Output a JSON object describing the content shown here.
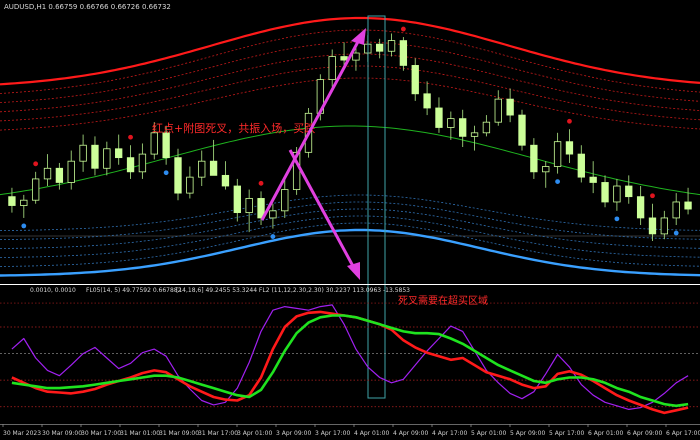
{
  "colors": {
    "background": "#000000",
    "candle_body": "#ccff99",
    "candle_wick": "#9fd27a",
    "upper_band_main": "#ff1a1a",
    "upper_band_dotted": "#c21a1a",
    "lower_band_main": "#3aa0ff",
    "lower_band_dotted": "#2f6fb0",
    "midline": "#1fb31f",
    "buy_dot": "#2d8cf0",
    "sell_dot": "#e0141e",
    "annotation_text": "#ff2a2a",
    "arrow": "#e040e0",
    "highlight_box": "#3fa3a8",
    "panel_divider": "#ffffff",
    "osc_fast": "#ff1a1a",
    "osc_slow": "#1fe31f",
    "osc_purple": "#a020f0",
    "osc_levels": "#b22222"
  },
  "main_panel": {
    "symbol_info": "AUDUSD,H1  0.66759 0.66766 0.66726 0.66732",
    "annotation": "红点+附图死叉，共振入场，买跌"
  },
  "sub_panel": {
    "info_left": "0.0010, 0.0010",
    "info_mid": "FL05(14, 5) 49.77592 0.667882",
    "info_right": "[14,18,6] 49.2455 53.3244  FL2 (11,12,2.30,2.30) 30.2237 113.0963 -13.5853",
    "annotation": "死叉需要在超买区域"
  },
  "x_axis": {
    "labels": [
      "30 Mar 2023",
      "30 Mar 09:00",
      "30 Mar 17:00",
      "31 Mar 01:00",
      "31 Mar 09:00",
      "31 Mar 17:00",
      "3 Apr 01:00",
      "3 Apr 09:00",
      "3 Apr 17:00",
      "4 Apr 01:00",
      "4 Apr 09:00",
      "4 Apr 17:00",
      "5 Apr 01:00",
      "5 Apr 09:00",
      "5 Apr 17:00",
      "6 Apr 01:00",
      "6 Apr 09:00",
      "6 Apr 17:00"
    ]
  },
  "chart_data": [
    {
      "type": "candlestick",
      "title": "AUDUSD,H1",
      "ylim": [
        0.6655,
        0.6805
      ],
      "candles": [
        {
          "o": 0.6702,
          "h": 0.6707,
          "l": 0.6693,
          "c": 0.6697
        },
        {
          "o": 0.6697,
          "h": 0.6703,
          "l": 0.669,
          "c": 0.67
        },
        {
          "o": 0.67,
          "h": 0.6716,
          "l": 0.6698,
          "c": 0.6712
        },
        {
          "o": 0.6712,
          "h": 0.6726,
          "l": 0.6708,
          "c": 0.6718
        },
        {
          "o": 0.6718,
          "h": 0.6721,
          "l": 0.6706,
          "c": 0.671
        },
        {
          "o": 0.671,
          "h": 0.6728,
          "l": 0.6706,
          "c": 0.6722
        },
        {
          "o": 0.6722,
          "h": 0.6737,
          "l": 0.6716,
          "c": 0.6731
        },
        {
          "o": 0.6731,
          "h": 0.6736,
          "l": 0.6714,
          "c": 0.6718
        },
        {
          "o": 0.6718,
          "h": 0.6733,
          "l": 0.6714,
          "c": 0.6729
        },
        {
          "o": 0.6729,
          "h": 0.6737,
          "l": 0.672,
          "c": 0.6724
        },
        {
          "o": 0.6724,
          "h": 0.6731,
          "l": 0.6712,
          "c": 0.6716
        },
        {
          "o": 0.6716,
          "h": 0.6732,
          "l": 0.6712,
          "c": 0.6726
        },
        {
          "o": 0.6726,
          "h": 0.6744,
          "l": 0.6723,
          "c": 0.6738
        },
        {
          "o": 0.6738,
          "h": 0.6742,
          "l": 0.672,
          "c": 0.6724
        },
        {
          "o": 0.6724,
          "h": 0.6729,
          "l": 0.67,
          "c": 0.6704
        },
        {
          "o": 0.6704,
          "h": 0.6719,
          "l": 0.6701,
          "c": 0.6713
        },
        {
          "o": 0.6713,
          "h": 0.6728,
          "l": 0.6708,
          "c": 0.6722
        },
        {
          "o": 0.6722,
          "h": 0.6734,
          "l": 0.6716,
          "c": 0.6714
        },
        {
          "o": 0.6714,
          "h": 0.6722,
          "l": 0.6706,
          "c": 0.6708
        },
        {
          "o": 0.6708,
          "h": 0.6712,
          "l": 0.6688,
          "c": 0.6693
        },
        {
          "o": 0.6693,
          "h": 0.6706,
          "l": 0.6682,
          "c": 0.6701
        },
        {
          "o": 0.6701,
          "h": 0.6705,
          "l": 0.6686,
          "c": 0.669
        },
        {
          "o": 0.669,
          "h": 0.6698,
          "l": 0.6684,
          "c": 0.6694
        },
        {
          "o": 0.6694,
          "h": 0.6712,
          "l": 0.669,
          "c": 0.6706
        },
        {
          "o": 0.6706,
          "h": 0.673,
          "l": 0.6703,
          "c": 0.6727
        },
        {
          "o": 0.6727,
          "h": 0.6752,
          "l": 0.6724,
          "c": 0.6749
        },
        {
          "o": 0.6749,
          "h": 0.6771,
          "l": 0.6745,
          "c": 0.6768
        },
        {
          "o": 0.6768,
          "h": 0.6785,
          "l": 0.6764,
          "c": 0.6781
        },
        {
          "o": 0.6781,
          "h": 0.6789,
          "l": 0.6774,
          "c": 0.6779
        },
        {
          "o": 0.6779,
          "h": 0.6786,
          "l": 0.6773,
          "c": 0.6783
        },
        {
          "o": 0.6783,
          "h": 0.6793,
          "l": 0.6778,
          "c": 0.6788
        },
        {
          "o": 0.6788,
          "h": 0.6791,
          "l": 0.678,
          "c": 0.6784
        },
        {
          "o": 0.6784,
          "h": 0.6794,
          "l": 0.6781,
          "c": 0.679
        },
        {
          "o": 0.679,
          "h": 0.6792,
          "l": 0.6773,
          "c": 0.6776
        },
        {
          "o": 0.6776,
          "h": 0.678,
          "l": 0.6756,
          "c": 0.676
        },
        {
          "o": 0.676,
          "h": 0.6767,
          "l": 0.6748,
          "c": 0.6752
        },
        {
          "o": 0.6752,
          "h": 0.6758,
          "l": 0.6738,
          "c": 0.6741
        },
        {
          "o": 0.6741,
          "h": 0.675,
          "l": 0.6734,
          "c": 0.6746
        },
        {
          "o": 0.6746,
          "h": 0.6751,
          "l": 0.673,
          "c": 0.6736
        },
        {
          "o": 0.6736,
          "h": 0.6742,
          "l": 0.6728,
          "c": 0.6738
        },
        {
          "o": 0.6738,
          "h": 0.6748,
          "l": 0.6736,
          "c": 0.6744
        },
        {
          "o": 0.6744,
          "h": 0.6762,
          "l": 0.6742,
          "c": 0.6757
        },
        {
          "o": 0.6757,
          "h": 0.6763,
          "l": 0.6744,
          "c": 0.6748
        },
        {
          "o": 0.6748,
          "h": 0.6751,
          "l": 0.6728,
          "c": 0.6731
        },
        {
          "o": 0.6731,
          "h": 0.6735,
          "l": 0.6712,
          "c": 0.6716
        },
        {
          "o": 0.6716,
          "h": 0.6722,
          "l": 0.6707,
          "c": 0.6719
        },
        {
          "o": 0.6719,
          "h": 0.6738,
          "l": 0.6715,
          "c": 0.6733
        },
        {
          "o": 0.6733,
          "h": 0.674,
          "l": 0.6721,
          "c": 0.6726
        },
        {
          "o": 0.6726,
          "h": 0.6731,
          "l": 0.671,
          "c": 0.6713
        },
        {
          "o": 0.6713,
          "h": 0.6722,
          "l": 0.6704,
          "c": 0.671
        },
        {
          "o": 0.671,
          "h": 0.6714,
          "l": 0.6696,
          "c": 0.6699
        },
        {
          "o": 0.6699,
          "h": 0.6712,
          "l": 0.6694,
          "c": 0.6708
        },
        {
          "o": 0.6708,
          "h": 0.6714,
          "l": 0.6698,
          "c": 0.6702
        },
        {
          "o": 0.6702,
          "h": 0.6708,
          "l": 0.6686,
          "c": 0.669
        },
        {
          "o": 0.669,
          "h": 0.6698,
          "l": 0.6677,
          "c": 0.6681
        },
        {
          "o": 0.6681,
          "h": 0.6694,
          "l": 0.6678,
          "c": 0.669
        },
        {
          "o": 0.669,
          "h": 0.6704,
          "l": 0.6686,
          "c": 0.6699
        },
        {
          "o": 0.6699,
          "h": 0.6707,
          "l": 0.6692,
          "c": 0.6695
        }
      ]
    },
    {
      "type": "line",
      "title": "FL05(14, 5)",
      "ylim": [
        -20,
        120
      ],
      "levels": [
        -5,
        25,
        85,
        112
      ],
      "series": [
        {
          "name": "fast",
          "values": [
            28,
            22,
            16,
            12,
            11,
            10,
            12,
            15,
            20,
            24,
            28,
            33,
            36,
            34,
            26,
            18,
            12,
            6,
            3,
            2,
            8,
            28,
            60,
            85,
            97,
            101,
            102,
            100,
            98,
            96,
            92,
            88,
            82,
            70,
            62,
            56,
            52,
            48,
            50,
            42,
            34,
            30,
            26,
            20,
            16,
            18,
            32,
            35,
            31,
            24,
            16,
            8,
            2,
            -3,
            -8,
            -12,
            -9,
            -6
          ]
        },
        {
          "name": "slow",
          "values": [
            22,
            20,
            18,
            16,
            16,
            17,
            18,
            20,
            22,
            24,
            26,
            28,
            30,
            30,
            28,
            24,
            20,
            16,
            12,
            8,
            6,
            14,
            34,
            58,
            78,
            90,
            96,
            98,
            98,
            96,
            92,
            88,
            84,
            80,
            78,
            78,
            77,
            72,
            66,
            58,
            50,
            42,
            36,
            30,
            24,
            22,
            26,
            28,
            28,
            26,
            22,
            16,
            12,
            6,
            2,
            -2,
            -4,
            -2
          ]
        },
        {
          "name": "purple",
          "values": [
            60,
            72,
            50,
            36,
            30,
            42,
            55,
            62,
            50,
            38,
            44,
            56,
            60,
            52,
            30,
            15,
            2,
            -3,
            0,
            16,
            45,
            80,
            104,
            108,
            106,
            104,
            108,
            110,
            88,
            60,
            40,
            28,
            22,
            26,
            42,
            58,
            72,
            86,
            80,
            58,
            36,
            22,
            10,
            4,
            12,
            32,
            54,
            40,
            20,
            8,
            0,
            -4,
            -8,
            -6,
            0,
            10,
            22,
            30
          ]
        }
      ]
    }
  ]
}
